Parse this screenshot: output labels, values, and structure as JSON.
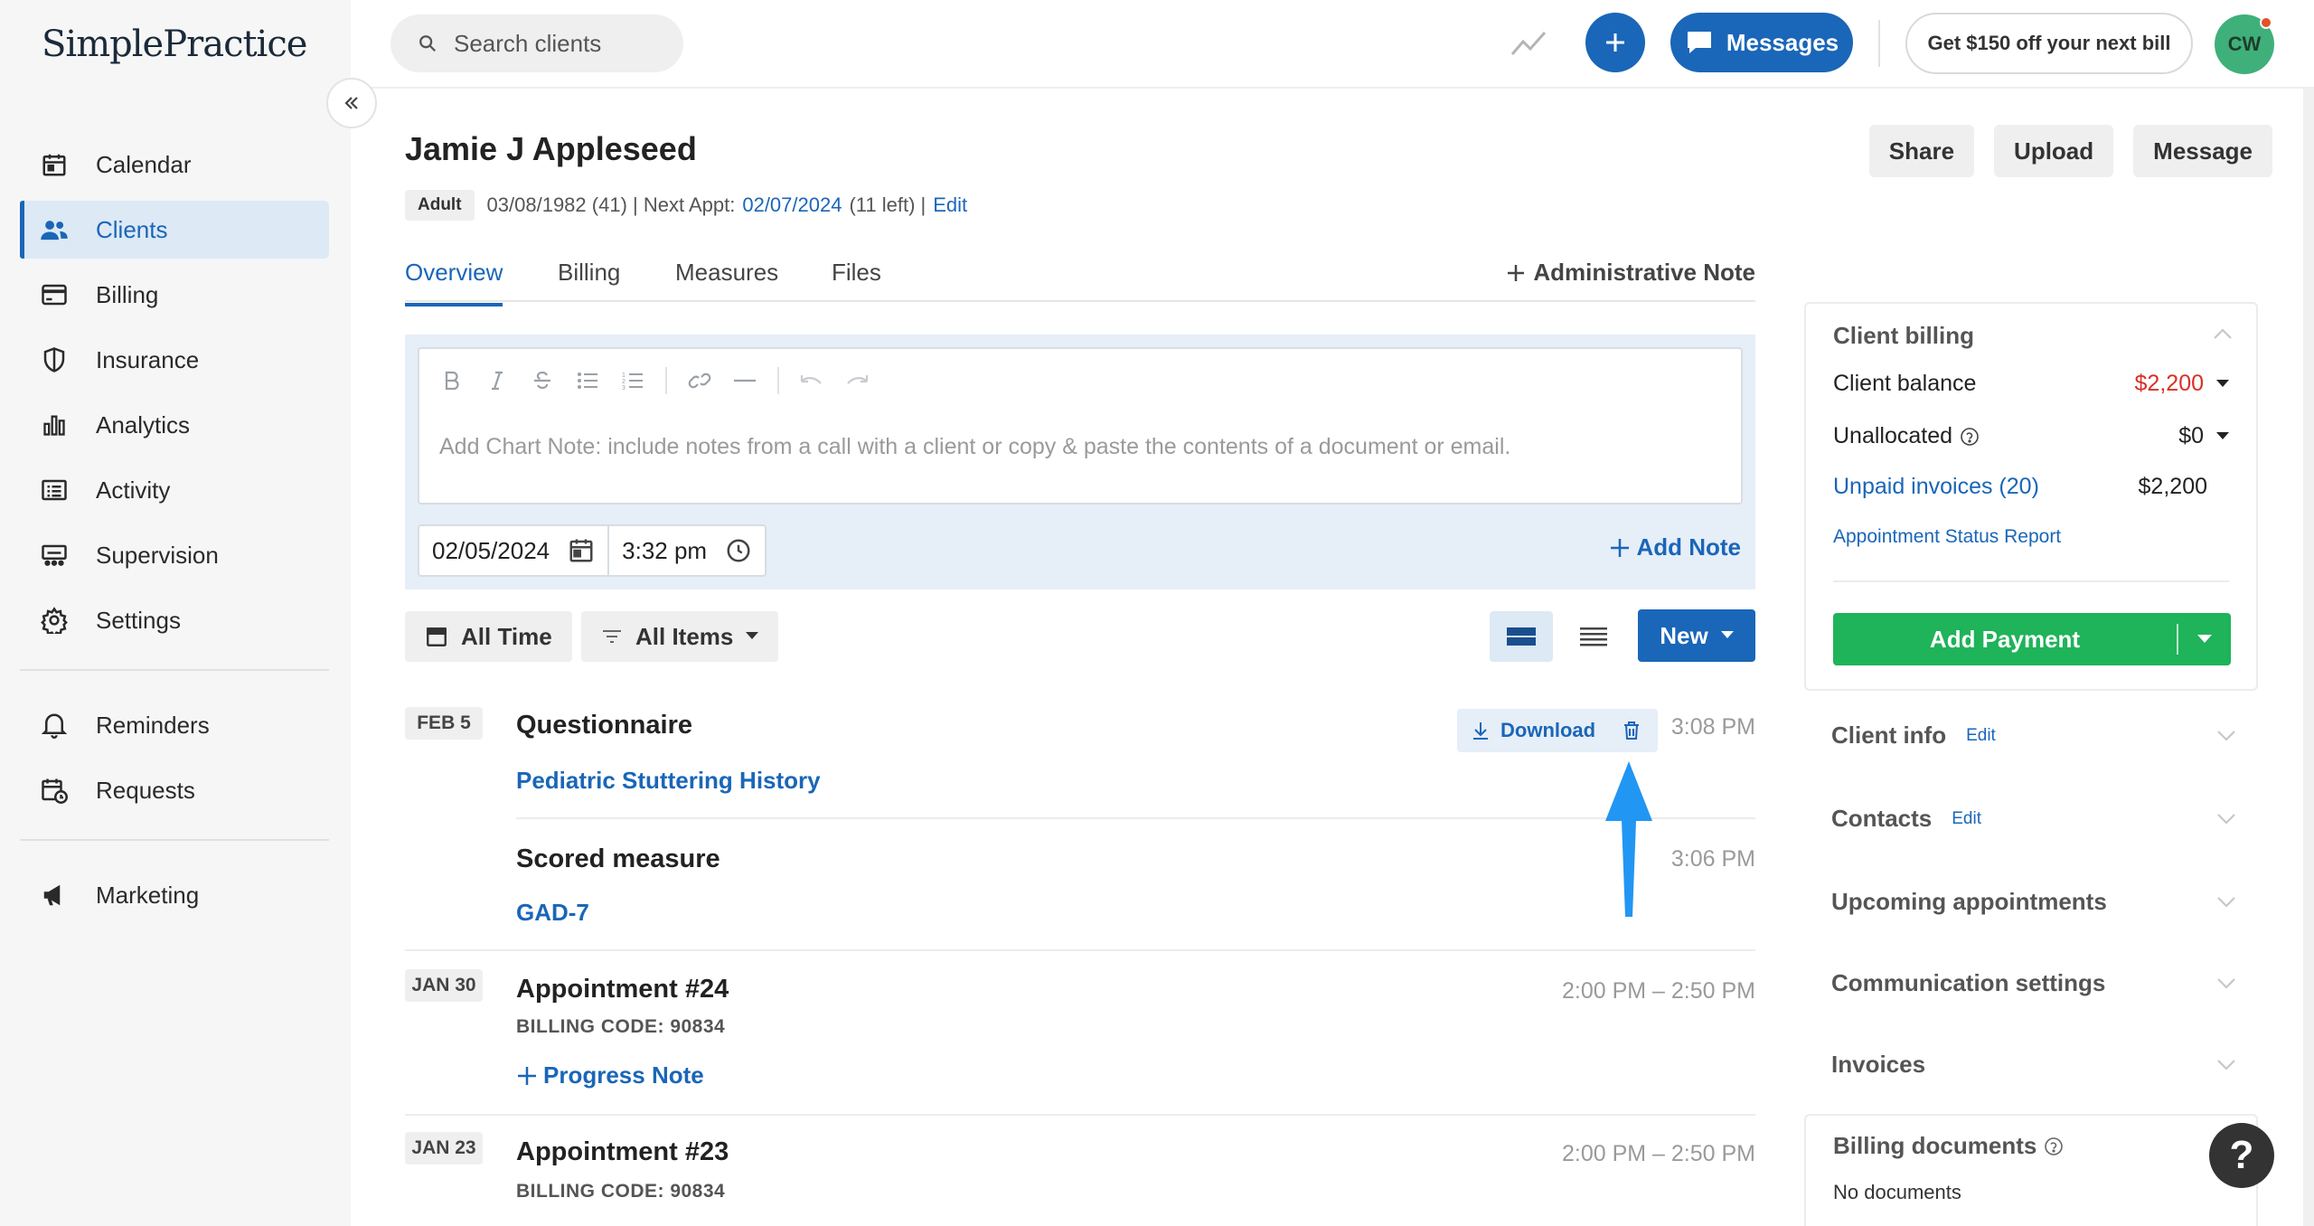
{
  "app": {
    "logo_text": "SimplePractice"
  },
  "search": {
    "placeholder": "Search clients"
  },
  "topbar": {
    "messages_label": "Messages",
    "promo_label": "Get $150 off your next bill",
    "avatar_initials": "CW"
  },
  "sidebar": {
    "items": [
      {
        "label": "Calendar",
        "icon": "calendar-icon"
      },
      {
        "label": "Clients",
        "icon": "users-icon",
        "active": true
      },
      {
        "label": "Billing",
        "icon": "credit-card-icon"
      },
      {
        "label": "Insurance",
        "icon": "shield-icon"
      },
      {
        "label": "Analytics",
        "icon": "bar-chart-icon"
      },
      {
        "label": "Activity",
        "icon": "list-icon"
      },
      {
        "label": "Supervision",
        "icon": "supervision-icon"
      },
      {
        "label": "Settings",
        "icon": "gear-icon"
      }
    ],
    "secondary": [
      {
        "label": "Reminders",
        "icon": "bell-icon"
      },
      {
        "label": "Requests",
        "icon": "calendar-clock-icon"
      }
    ],
    "tertiary": [
      {
        "label": "Marketing",
        "icon": "megaphone-icon"
      }
    ]
  },
  "client": {
    "name": "Jamie J Appleseed",
    "badge": "Adult",
    "dob": "03/08/1982 (41) | Next Appt:",
    "next_appt": "02/07/2024",
    "appts_left": "(11 left) |",
    "edit_label": "Edit"
  },
  "header_buttons": {
    "share": "Share",
    "upload": "Upload",
    "message": "Message"
  },
  "tabs": [
    {
      "label": "Overview",
      "active": true
    },
    {
      "label": "Billing"
    },
    {
      "label": "Measures"
    },
    {
      "label": "Files"
    }
  ],
  "admin_note_label": "Administrative Note",
  "note_editor": {
    "placeholder": "Add Chart Note: include notes from a call with a client or copy & paste the contents of a document or email.",
    "date": "02/05/2024",
    "time": "3:32 pm",
    "add_note_label": "Add Note"
  },
  "filters": {
    "time_label": "All Time",
    "items_label": "All Items",
    "new_label": "New"
  },
  "timeline": [
    {
      "date": "FEB 5",
      "entries": [
        {
          "title": "Questionnaire",
          "link": "Pediatric Stuttering History",
          "time": "3:08 PM",
          "download_label": "Download"
        },
        {
          "title": "Scored measure",
          "link": "GAD-7",
          "time": "3:06 PM"
        }
      ]
    },
    {
      "date": "JAN 30",
      "title": "Appointment #24",
      "billing_code": "BILLING CODE: 90834",
      "link": "Progress Note",
      "time": "2:00 PM – 2:50 PM"
    },
    {
      "date": "JAN 23",
      "title": "Appointment #23",
      "billing_code": "BILLING CODE: 90834",
      "time": "2:00 PM – 2:50 PM"
    }
  ],
  "client_billing": {
    "title": "Client billing",
    "balance_label": "Client balance",
    "balance_value": "$2,200",
    "unallocated_label": "Unallocated",
    "unallocated_value": "$0",
    "unpaid_label": "Unpaid invoices (20)",
    "unpaid_value": "$2,200",
    "status_report_label": "Appointment Status Report",
    "add_payment_label": "Add Payment"
  },
  "right_sections": [
    {
      "title": "Client info",
      "edit": "Edit"
    },
    {
      "title": "Contacts",
      "edit": "Edit"
    },
    {
      "title": "Upcoming appointments"
    },
    {
      "title": "Communication settings"
    },
    {
      "title": "Invoices"
    }
  ],
  "billing_documents": {
    "title": "Billing documents",
    "empty": "No documents"
  },
  "help_label": "?",
  "colors": {
    "brand_blue": "#1a66b8",
    "success_green": "#1fb35a",
    "balance_red": "#d93025"
  }
}
